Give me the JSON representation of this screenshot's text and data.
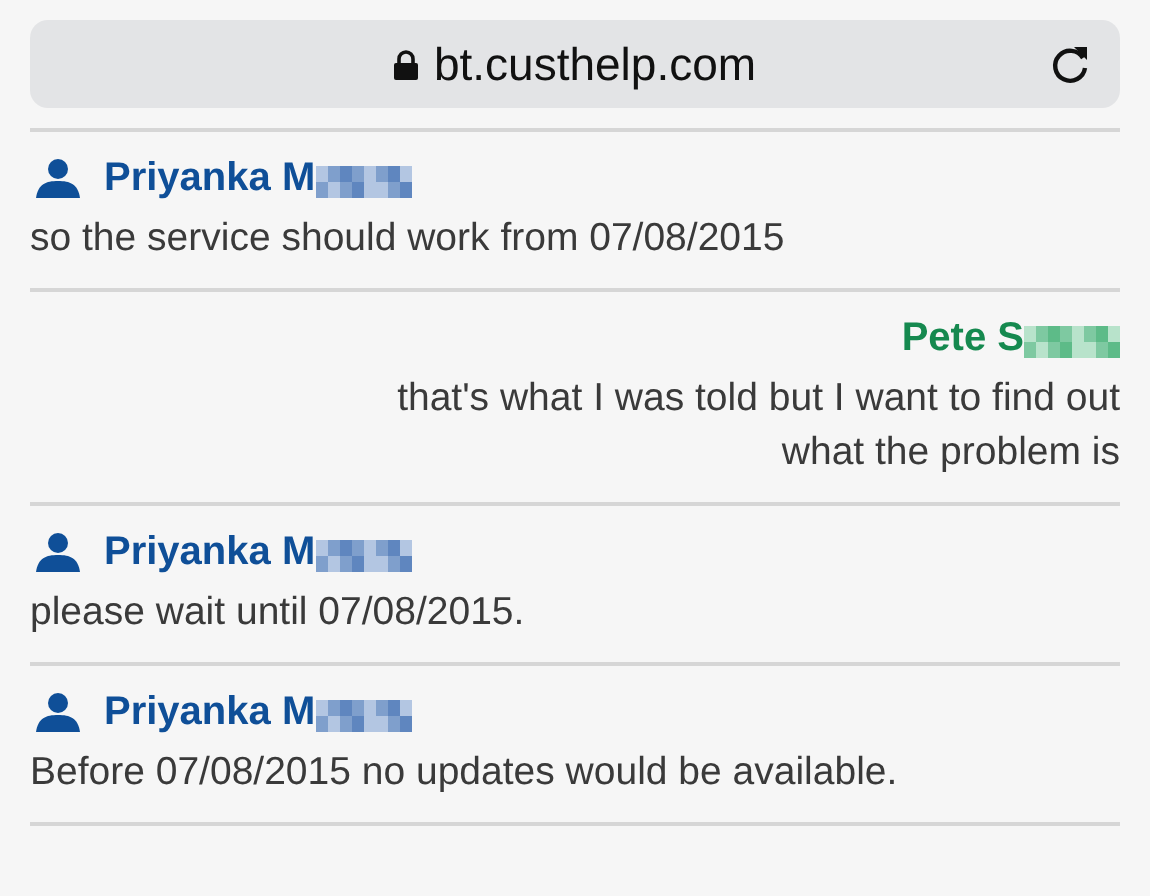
{
  "address_bar": {
    "url": "bt.custhelp.com"
  },
  "messages": [
    {
      "kind": "agent",
      "author": "Priyanka M",
      "text": "so the service should work from 07/08/2015"
    },
    {
      "kind": "customer",
      "author": "Pete S",
      "text": "that's what I was told but I want to find out what the problem is"
    },
    {
      "kind": "agent",
      "author": "Priyanka M",
      "text": "please wait until 07/08/2015."
    },
    {
      "kind": "agent",
      "author": "Priyanka M",
      "text": "Before 07/08/2015 no updates would be available."
    }
  ]
}
